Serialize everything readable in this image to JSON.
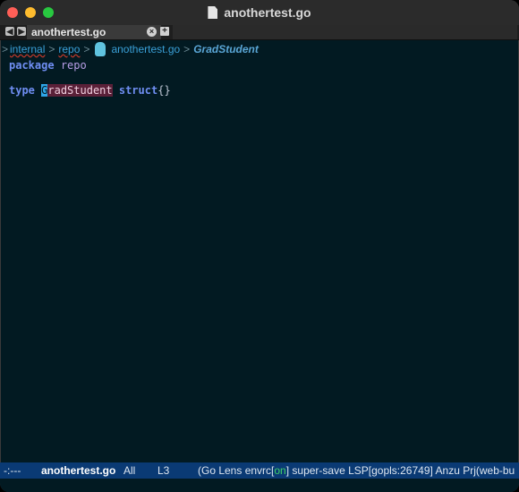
{
  "window": {
    "title": "anothertest.go"
  },
  "tabbar": {
    "prev_glyph": "◀",
    "next_glyph": "▶",
    "active_tab_label": "anothertest.go",
    "close_glyph": "×",
    "add_glyph": "+"
  },
  "breadcrumb": {
    "lead_sep": ">",
    "sep": ">",
    "items": [
      "internal",
      "repo",
      "anothertest.go",
      "GradStudent"
    ]
  },
  "code": {
    "line1": {
      "keyword": "package",
      "name": "repo"
    },
    "line3": {
      "keyword": "type",
      "cursor_char": "G",
      "name_rest": "radStudent",
      "keyword2": "struct",
      "body": "{}"
    }
  },
  "modeline": {
    "state": "-:---",
    "buffer": "anothertest.go",
    "position": "All",
    "line": "L3",
    "modes_prefix": "(Go Lens envrc[",
    "envrc_status": "on",
    "modes_suffix": "] super-save LSP[gopls:26749] Anzu Prj(web-bu"
  },
  "colors": {
    "background": "#021a22",
    "modeline_bg": "#0a3a74",
    "keyword": "#6f8ef2",
    "highlight": "#5a2038",
    "cursor": "#2fa6e8"
  }
}
